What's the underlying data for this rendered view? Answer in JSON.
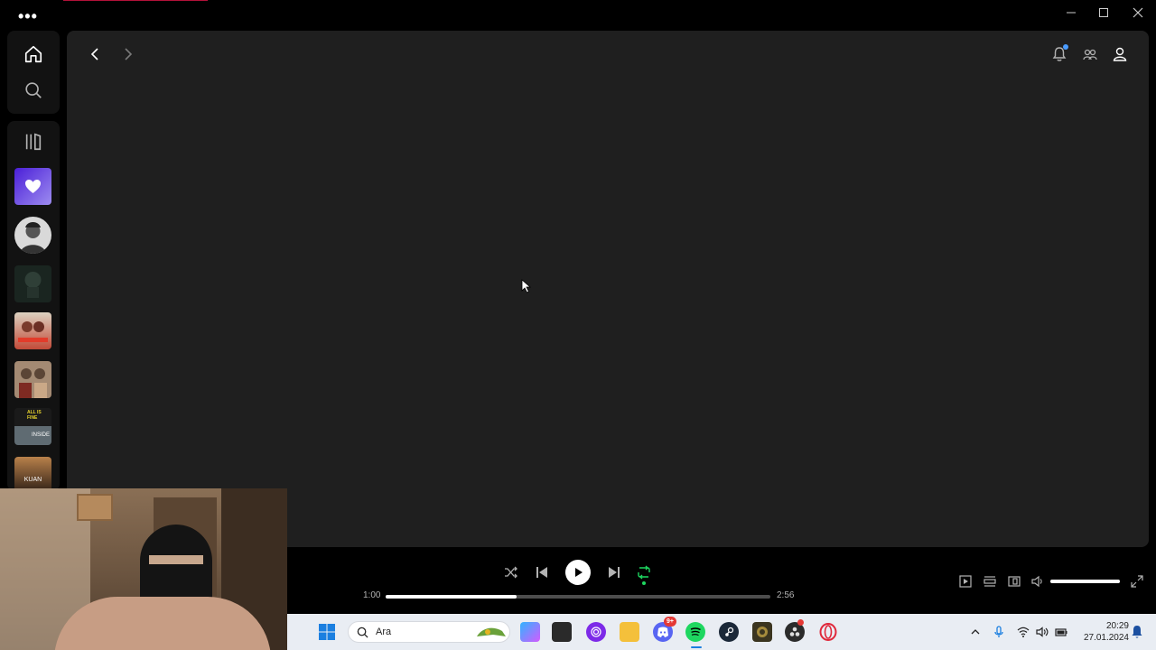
{
  "app": {
    "menu_icon": "more-dots-icon",
    "window_controls": [
      "minimize-icon",
      "maximize-icon",
      "close-icon"
    ]
  },
  "sidebar": {
    "nav": [
      {
        "name": "home",
        "icon": "home-icon"
      },
      {
        "name": "search",
        "icon": "search-icon"
      }
    ],
    "library_icon": "library-icon",
    "library_items": [
      {
        "name": "liked-songs",
        "color": "#6b3ff5"
      },
      {
        "name": "artist-avatar",
        "color": "#d9d9d9"
      },
      {
        "name": "playlist-dark",
        "color": "#1c2a24"
      },
      {
        "name": "playlist-red",
        "color": "#c4493a"
      },
      {
        "name": "playlist-duo",
        "color": "#a08670"
      },
      {
        "name": "playlist-inside",
        "label": "INSIDE",
        "color": "#3a3a3a"
      },
      {
        "name": "playlist-kuan",
        "label": "KUAN",
        "color": "#6a4a2e"
      }
    ]
  },
  "header": {
    "back_icon": "chevron-left-icon",
    "forward_icon": "chevron-right-icon",
    "right_icons": [
      "bell-icon",
      "friends-icon",
      "user-icon"
    ],
    "notification_dot_color": "#4a9cff"
  },
  "player": {
    "current_time": "1:00",
    "total_time": "2:56",
    "progress": 0.34,
    "volume": 1.0,
    "repeat_color": "#1ed760",
    "controls": [
      "shuffle-icon",
      "previous-icon",
      "play-icon",
      "next-icon",
      "repeat-icon"
    ],
    "right_controls": [
      "now-playing-view-icon",
      "queue-icon",
      "connect-device-icon",
      "volume-icon",
      "fullscreen-icon"
    ]
  },
  "taskbar": {
    "search_placeholder": "Ara",
    "apps": [
      "windows-start-icon",
      "copilot-icon",
      "window-icon",
      "tor-icon",
      "file-explorer-icon",
      "discord-icon",
      "spotify-icon",
      "steam-icon",
      "game-icon",
      "obs-icon",
      "opera-icon"
    ],
    "discord_badge": "9+",
    "time": "20:29",
    "date": "27.01.2024"
  }
}
